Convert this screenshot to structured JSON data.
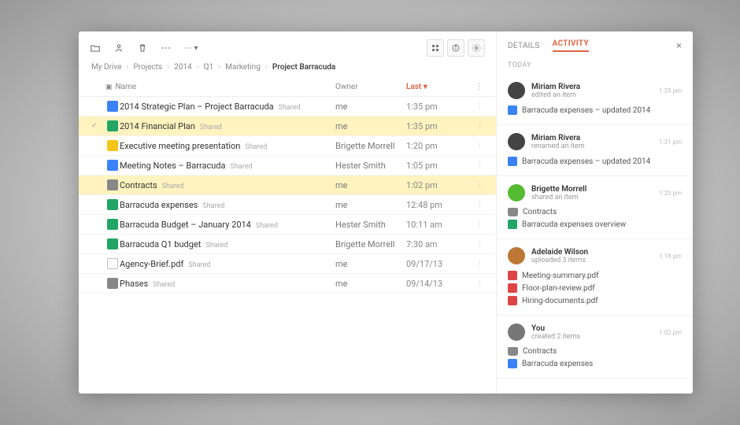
{
  "toolbar": {
    "right_labels": [
      "grid",
      "info",
      "gear"
    ]
  },
  "breadcrumb": [
    "My Drive",
    "Projects",
    "2014",
    "Q1",
    "Marketing",
    "Project Barracuda"
  ],
  "columns": {
    "name": "Name",
    "owner": "Owner",
    "modified": "Last ▾"
  },
  "files": [
    {
      "icon": "blue",
      "name": "2014 Strategic Plan – Project Barracuda",
      "shared": "Shared",
      "owner": "me",
      "modified": "1:35 pm",
      "selected": false,
      "checked": false
    },
    {
      "icon": "green",
      "name": "2014 Financial Plan",
      "shared": "Shared",
      "owner": "me",
      "modified": "1:35 pm",
      "selected": true,
      "checked": true
    },
    {
      "icon": "yellow",
      "name": "Executive meeting presentation",
      "shared": "Shared",
      "owner": "Brigette Morrell",
      "modified": "1:20 pm",
      "selected": false,
      "checked": false
    },
    {
      "icon": "blue",
      "name": "Meeting Notes – Barracuda",
      "shared": "Shared",
      "owner": "Hester Smith",
      "modified": "1:05 pm",
      "selected": false,
      "checked": false
    },
    {
      "icon": "folder",
      "name": "Contracts",
      "shared": "Shared",
      "owner": "me",
      "modified": "1:02 pm",
      "selected": true,
      "checked": false
    },
    {
      "icon": "green",
      "name": "Barracuda expenses",
      "shared": "Shared",
      "owner": "me",
      "modified": "12:48 pm",
      "selected": false,
      "checked": false
    },
    {
      "icon": "green",
      "name": "Barracuda Budget – January 2014",
      "shared": "Shared",
      "owner": "Hester Smith",
      "modified": "10:11 am",
      "selected": false,
      "checked": false
    },
    {
      "icon": "green",
      "name": "Barracuda Q1 budget",
      "shared": "Shared",
      "owner": "Brigette Morrell",
      "modified": "7:30 am",
      "selected": false,
      "checked": false
    },
    {
      "icon": "gray",
      "name": "Agency-Brief.pdf",
      "shared": "Shared",
      "owner": "me",
      "modified": "09/17/13",
      "selected": false,
      "checked": false
    },
    {
      "icon": "folder",
      "name": "Phases",
      "shared": "Shared",
      "owner": "me",
      "modified": "09/14/13",
      "selected": false,
      "checked": false
    }
  ],
  "side": {
    "tabs": [
      "DETAILS",
      "ACTIVITY"
    ],
    "active_tab": 1,
    "subheading": "TODAY",
    "activities": [
      {
        "avatar_bg": "#444",
        "person": "Miriam Rivera",
        "action": "edited an item",
        "time": "1:35 pm",
        "attachments": [
          {
            "type": "blue",
            "label": "Barracuda expenses – updated 2014"
          }
        ]
      },
      {
        "avatar_bg": "#444",
        "person": "Miriam Rivera",
        "action": "renamed an item",
        "time": "1:31 pm",
        "attachments": [
          {
            "type": "blue",
            "label": "Barracuda expenses – updated 2014"
          }
        ]
      },
      {
        "avatar_bg": "#5b3",
        "person": "Brigette Morrell",
        "action": "shared an item",
        "time": "1:20 pm",
        "attachments": [
          {
            "type": "folder",
            "label": "Contracts"
          },
          {
            "type": "green",
            "label": "Barracuda expenses overview"
          }
        ]
      },
      {
        "avatar_bg": "#b73",
        "person": "Adelaide Wilson",
        "action": "uploaded 3 items",
        "time": "1:18 pm",
        "attachments": [
          {
            "type": "pdf",
            "label": "Meeting-summary.pdf"
          },
          {
            "type": "pdf",
            "label": "Floor-plan-review.pdf"
          },
          {
            "type": "pdf",
            "label": "Hiring-documents.pdf"
          }
        ]
      },
      {
        "avatar_bg": "#777",
        "person": "You",
        "action": "created 2 items",
        "time": "1:02 pm",
        "attachments": [
          {
            "type": "folder",
            "label": "Contracts"
          },
          {
            "type": "blue",
            "label": "Barracuda expenses"
          }
        ]
      }
    ]
  }
}
